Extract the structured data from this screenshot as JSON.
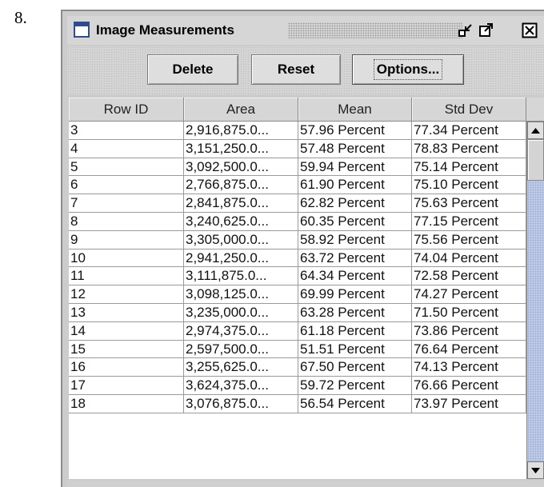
{
  "step_number": "8.",
  "window": {
    "title": "Image Measurements"
  },
  "toolbar": {
    "delete_label": "Delete",
    "reset_label": "Reset",
    "options_label": "Options..."
  },
  "table": {
    "columns": [
      "Row ID",
      "Area",
      "Mean",
      "Std Dev"
    ],
    "rows": [
      [
        "3",
        "2,916,875.0...",
        "57.96 Percent",
        "77.34 Percent"
      ],
      [
        "4",
        "3,151,250.0...",
        "57.48 Percent",
        "78.83 Percent"
      ],
      [
        "5",
        "3,092,500.0...",
        "59.94 Percent",
        "75.14 Percent"
      ],
      [
        "6",
        "2,766,875.0...",
        "61.90 Percent",
        "75.10 Percent"
      ],
      [
        "7",
        "2,841,875.0...",
        "62.82 Percent",
        "75.63 Percent"
      ],
      [
        "8",
        "3,240,625.0...",
        "60.35 Percent",
        "77.15 Percent"
      ],
      [
        "9",
        "3,305,000.0...",
        "58.92 Percent",
        "75.56 Percent"
      ],
      [
        "10",
        "2,941,250.0...",
        "63.72 Percent",
        "74.04 Percent"
      ],
      [
        "11",
        "3,111,875.0...",
        "64.34 Percent",
        "72.58 Percent"
      ],
      [
        "12",
        "3,098,125.0...",
        "69.99 Percent",
        "74.27 Percent"
      ],
      [
        "13",
        "3,235,000.0...",
        "63.28 Percent",
        "71.50 Percent"
      ],
      [
        "14",
        "2,974,375.0...",
        "61.18 Percent",
        "73.86 Percent"
      ],
      [
        "15",
        "2,597,500.0...",
        "51.51 Percent",
        "76.64 Percent"
      ],
      [
        "16",
        "3,255,625.0...",
        "67.50 Percent",
        "74.13 Percent"
      ],
      [
        "17",
        "3,624,375.0...",
        "59.72 Percent",
        "76.66 Percent"
      ],
      [
        "18",
        "3,076,875.0...",
        "56.54 Percent",
        "73.97 Percent"
      ]
    ]
  },
  "colors": {
    "window_bg": "#cccccc",
    "scrollbar_track": "#c2cbe6",
    "icon_blue": "#304c8c"
  },
  "icons": {
    "window": "window-icon",
    "minimize": "minimize-icon",
    "maximize": "maximize-icon",
    "close": "close-icon",
    "scroll_up": "arrow-up-icon",
    "scroll_down": "arrow-down-icon"
  }
}
